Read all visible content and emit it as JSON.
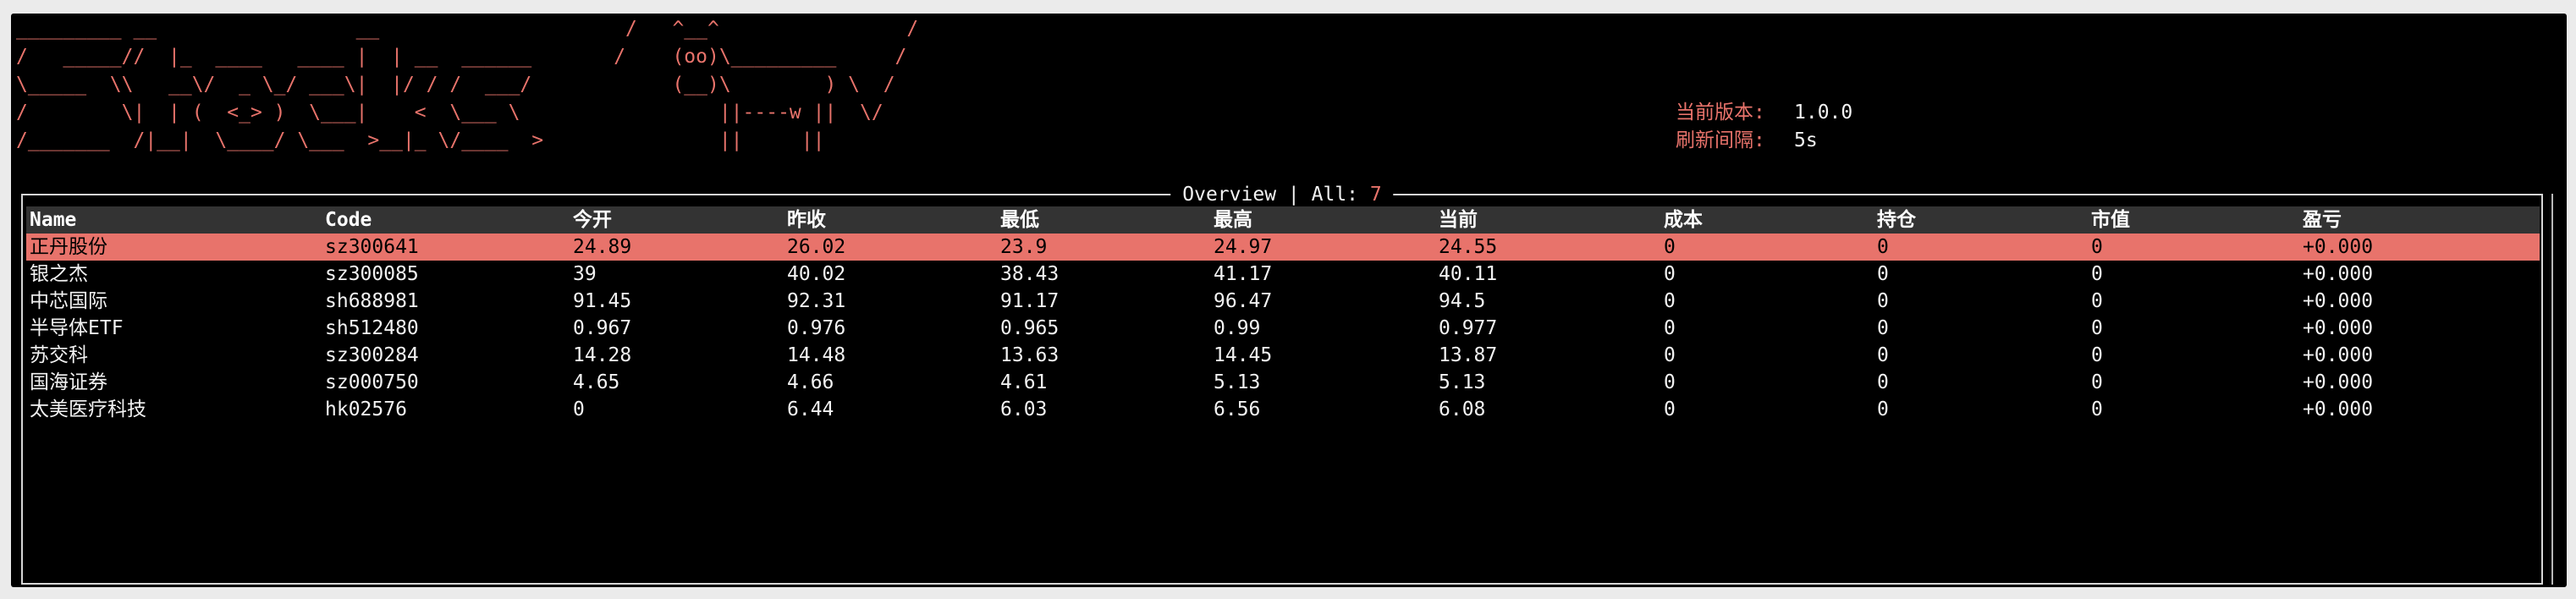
{
  "theme": {
    "accent": "#e8736b",
    "background": "#000000",
    "text": "#f2f2f2",
    "header_bg": "#333333",
    "selected_bg": "#e8736b",
    "selected_text": "#000000",
    "border": "#d6d6d6"
  },
  "banner": {
    "lines": [
      "_________ __                 __                     /   ^__^                /",
      "/   _____//  |_  ____   ____ |  | __  ______       /    (oo)\\_________     /",
      "\\_____  \\\\   __\\/  _ \\_/ ___\\|  |/ / /  ___/            (__)\\        ) \\  /",
      "/        \\|  | (  <_> )  \\___|    <  \\___ \\                 ||----w ||  \\/",
      "/_______  /|__|  \\____/ \\___  >__|_ \\/____  >               ||     ||"
    ]
  },
  "info": {
    "version_label": "当前版本:",
    "version": "1.0.0",
    "refresh_label": "刷新间隔:",
    "refresh": "5s"
  },
  "panel": {
    "title": "Overview",
    "separator": "|",
    "count_label": "All:",
    "count": "7"
  },
  "table": {
    "columns": [
      "Name",
      "Code",
      "今开",
      "昨收",
      "最低",
      "最高",
      "当前",
      "成本",
      "持仓",
      "市值",
      "盈亏"
    ],
    "selected_row": 0,
    "rows": [
      [
        "正丹股份",
        "sz300641",
        "24.89",
        "26.02",
        "23.9",
        "24.97",
        "24.55",
        "0",
        "0",
        "0",
        "+0.000"
      ],
      [
        "银之杰",
        "sz300085",
        "39",
        "40.02",
        "38.43",
        "41.17",
        "40.11",
        "0",
        "0",
        "0",
        "+0.000"
      ],
      [
        "中芯国际",
        "sh688981",
        "91.45",
        "92.31",
        "91.17",
        "96.47",
        "94.5",
        "0",
        "0",
        "0",
        "+0.000"
      ],
      [
        "半导体ETF",
        "sh512480",
        "0.967",
        "0.976",
        "0.965",
        "0.99",
        "0.977",
        "0",
        "0",
        "0",
        "+0.000"
      ],
      [
        "苏交科",
        "sz300284",
        "14.28",
        "14.48",
        "13.63",
        "14.45",
        "13.87",
        "0",
        "0",
        "0",
        "+0.000"
      ],
      [
        "国海证券",
        "sz000750",
        "4.65",
        "4.66",
        "4.61",
        "5.13",
        "5.13",
        "0",
        "0",
        "0",
        "+0.000"
      ],
      [
        "太美医疗科技",
        "hk02576",
        "0",
        "6.44",
        "6.03",
        "6.56",
        "6.08",
        "0",
        "0",
        "0",
        "+0.000"
      ]
    ]
  }
}
